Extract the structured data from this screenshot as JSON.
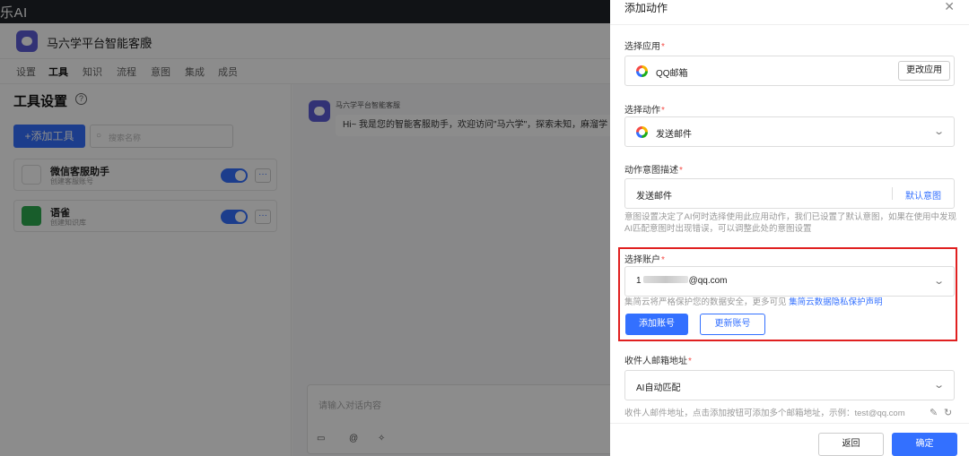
{
  "topbar": {
    "brand": "乐AI"
  },
  "app": {
    "name": "马六学平台智能客服"
  },
  "app_tabs": [
    "设置",
    "工具",
    "知识",
    "流程",
    "意图",
    "集成",
    "成员"
  ],
  "tools": {
    "title": "工具设置",
    "add_label": "+添加工具",
    "search_placeholder": "搜索名称",
    "items": [
      {
        "name": "微信客服助手",
        "desc": "创建客服账号"
      },
      {
        "name": "语雀",
        "desc": "创建知识库"
      }
    ]
  },
  "chat": {
    "bot_name": "马六学平台智能客服",
    "message": "Hi~ 我是您的智能客服助手，欢迎访问\"马六学\"，探索未知，麻溜学",
    "input_placeholder": "请输入对话内容"
  },
  "drawer": {
    "title": "添加动作",
    "select_app_label": "选择应用",
    "app_value": "QQ邮箱",
    "change_app_label": "更改应用",
    "select_action_label": "选择动作",
    "action_value": "发送邮件",
    "intent_label": "动作意图描述",
    "intent_value": "发送邮件",
    "default_intent_label": "默认意图",
    "intent_hint": "意图设置决定了AI何时选择使用此应用动作，我们已设置了默认意图，如果在使用中发现AI匹配意图时出现错误，可以调整此处的意图设置",
    "account_label": "选择账户",
    "account_prefix": "1",
    "account_suffix": "@qq.com",
    "privacy_hint": "集简云将严格保护您的数据安全，更多可见",
    "privacy_link": "集简云数据隐私保护声明",
    "add_account_label": "添加账号",
    "update_account_label": "更新账号",
    "recipient_label": "收件人邮箱地址",
    "recipient_value": "AI自动匹配",
    "recipient_hint": "收件人邮件地址，点击添加按钮可添加多个邮箱地址，示例：test@qq.com",
    "back_label": "返回",
    "confirm_label": "确定"
  },
  "colors": {
    "accent": "#3370ff",
    "highlight": "#e02020",
    "required": "#f54a45"
  }
}
